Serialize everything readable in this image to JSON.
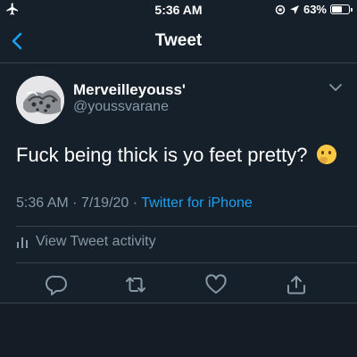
{
  "status_bar": {
    "time": "5:36 AM",
    "battery": "63%",
    "battery_level": 0.63
  },
  "nav": {
    "title": "Tweet",
    "back_icon": "chevron-left-icon"
  },
  "tweet": {
    "display_name": "Merveilleyouss'",
    "handle": "@youssvarane",
    "text": "Fuck being thick is yo feet pretty?",
    "emoji": "thinking-face",
    "time": "5:36 AM",
    "date": "7/19/20",
    "separator": "·",
    "source": "Twitter for iPhone"
  },
  "activity_label": "View Tweet activity",
  "colors": {
    "background": "#15202b",
    "accent": "#1da1f2",
    "secondary_text": "#8899a6",
    "divider": "#38444d"
  },
  "icons": {
    "reply": "reply-icon",
    "retweet": "retweet-icon",
    "like": "heart-icon",
    "share": "share-icon"
  }
}
